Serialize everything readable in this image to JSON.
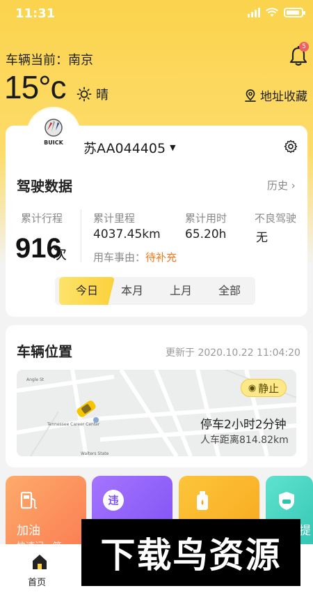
{
  "status_bar": {
    "time": "11:31"
  },
  "header": {
    "location_label": "车辆当前：南京",
    "temperature": "15°c",
    "weather": "晴",
    "address_label": "地址收藏",
    "notification_count": "5"
  },
  "vehicle": {
    "brand": "BUICK",
    "plate": "苏AA044405"
  },
  "driving": {
    "title": "驾驶数据",
    "history_label": "历史",
    "trips_label": "累计行程",
    "trips_value": "916",
    "trips_unit": "次",
    "mileage_label": "累计里程",
    "mileage_value": "4037.45km",
    "duration_label": "累计用时",
    "duration_value": "65.20h",
    "bad_driving_label": "不良驾驶",
    "bad_driving_value": "无",
    "reason_label": "用车事由：",
    "reason_value": "待补充",
    "tabs": [
      "今日",
      "本月",
      "上月",
      "全部"
    ]
  },
  "position": {
    "title": "车辆位置",
    "updated": "更新于 2020.10.22 11:04:20",
    "status": "静止",
    "parked": "停车2小时2分钟",
    "distance": "人车距离814.82km",
    "map_labels": [
      "Angle St",
      "Tennessee Career Center",
      "Walters State"
    ]
  },
  "services": [
    {
      "label": "加油",
      "sub": "快速记一笔",
      "icon": "fuel-pump-icon",
      "color": "#fc8a5a"
    },
    {
      "label": "违",
      "sub": "",
      "icon": "violation-icon",
      "color": "#8a5cf6"
    },
    {
      "label": "",
      "sub": "",
      "icon": "oil-bottle-icon",
      "color": "#fbb526"
    },
    {
      "label": "提",
      "sub": "",
      "icon": "shield-car-icon",
      "color": "#3fd3c0"
    }
  ],
  "nav": {
    "home": "首页"
  },
  "watermark": "下载鸟资源",
  "colors": {
    "accent": "#fbd34d",
    "orange": "#f07a1e"
  }
}
